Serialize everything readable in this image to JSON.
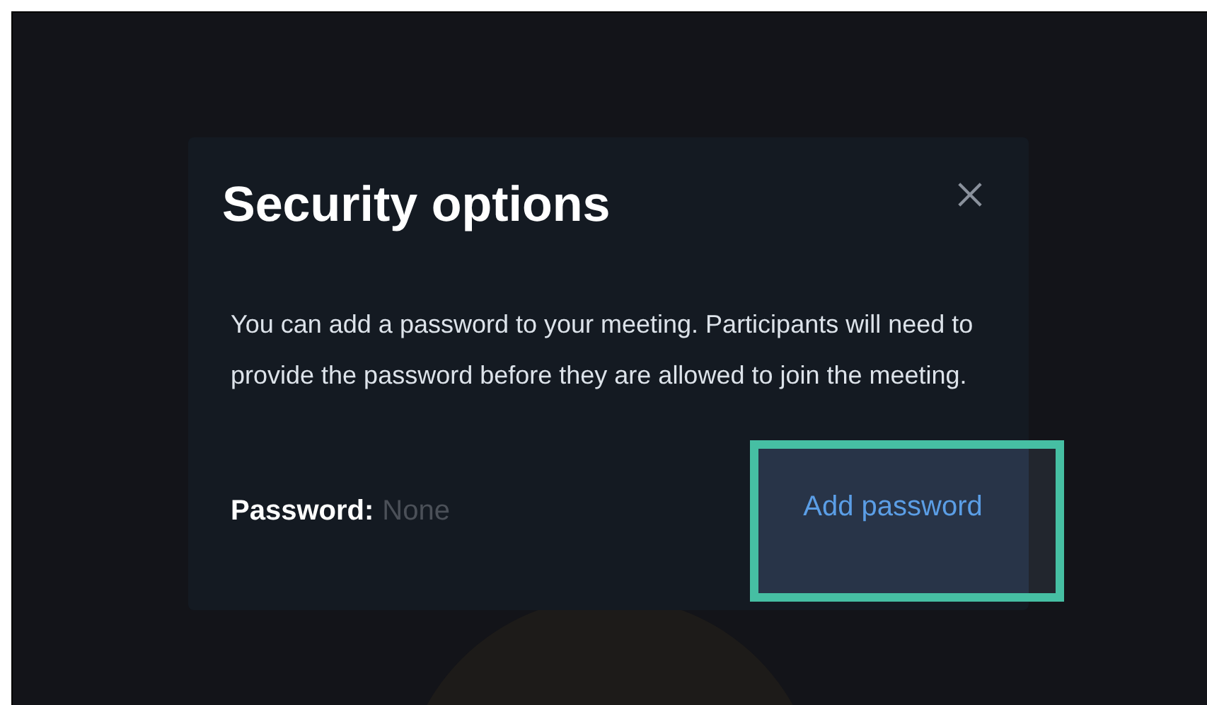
{
  "dialog": {
    "title": "Security options",
    "description": "You can add a password to your meeting. Participants will need to provide the password before they are allowed to join the meeting.",
    "password_label": "Password:",
    "password_value": "None",
    "button": "Add password",
    "button_highlighted": true
  }
}
